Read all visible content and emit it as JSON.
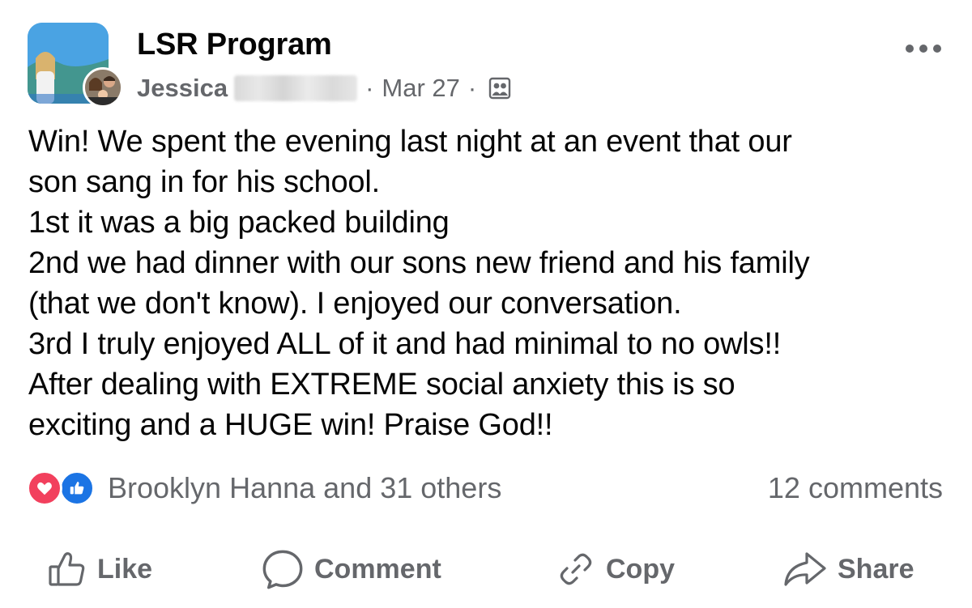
{
  "post": {
    "group_name": "LSR Program",
    "author_first_name": "Jessica",
    "separator": "·",
    "date": "Mar 27",
    "privacy_icon": "group-members-icon",
    "more_icon": "more-dots-icon",
    "body_lines": [
      "Win! We spent the evening last night at an event that our",
      "son sang in for his school.",
      "1st it was a big packed building",
      "2nd we had dinner with our sons new friend and his family",
      "(that we don't know). I enjoyed our conversation.",
      "3rd I truly enjoyed ALL of it and had minimal to no owls!!",
      "After dealing with EXTREME social anxiety this is so",
      "exciting and a HUGE win! Praise God!!"
    ]
  },
  "engagement": {
    "reaction_icons": [
      "love-icon",
      "like-icon"
    ],
    "reactions_text": "Brooklyn Hanna and 31 others",
    "comments_text": "12 comments"
  },
  "actions": {
    "like_label": "Like",
    "comment_label": "Comment",
    "copy_label": "Copy",
    "share_label": "Share"
  },
  "colors": {
    "text_primary": "#050505",
    "text_secondary": "#65676b",
    "love_red": "#f2405d",
    "like_blue": "#1b74e4"
  }
}
